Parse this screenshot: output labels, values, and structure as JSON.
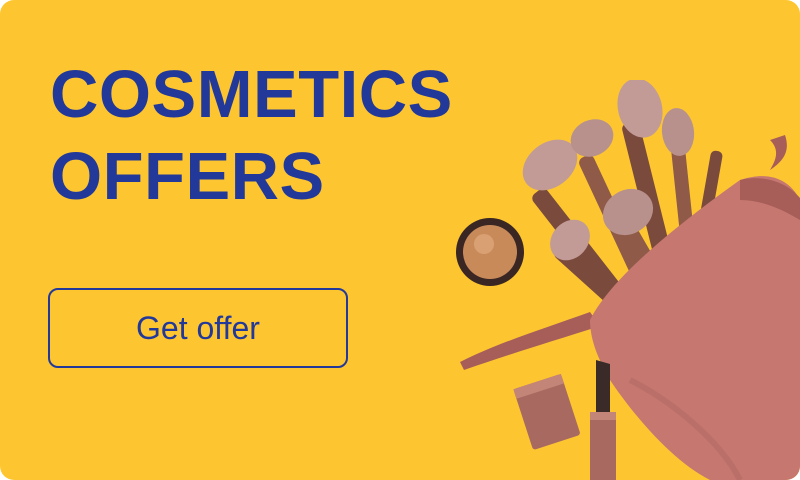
{
  "banner": {
    "headline_line1": "COSMETICS",
    "headline_line2": "OFFERS",
    "cta_label": "Get offer",
    "illustration": "makeup-brushes-pouch-eyeshadow-lipstick"
  },
  "colors": {
    "background": "#fdc631",
    "brand_blue": "#23399a",
    "pouch": "#c57770",
    "pouch_dark": "#a85e58",
    "brush_handle": "#7a4a3c",
    "brush_ferrule": "#8f5a48",
    "bristle": "#c29a96",
    "eyeshadow": "#c98a5a",
    "lipstick_case": "#a86a60",
    "lipstick_bullet": "#3a2a28"
  }
}
